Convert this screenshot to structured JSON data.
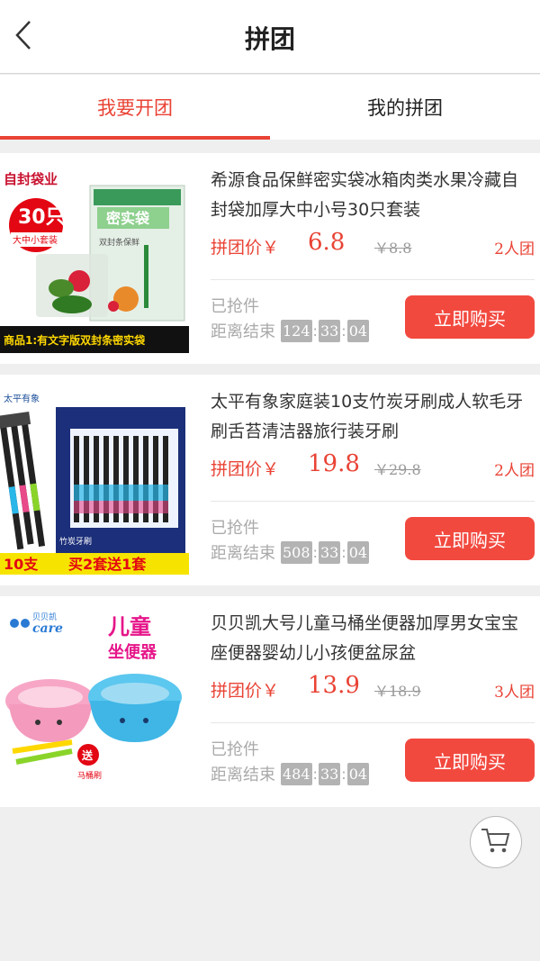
{
  "header": {
    "title": "拼团"
  },
  "tabs": [
    {
      "label": "我要开团",
      "active": true
    },
    {
      "label": "我的拼团",
      "active": false
    }
  ],
  "products": [
    {
      "title": "希源食品保鲜密实袋冰箱肉类水果冷藏自封袋加厚大中小号30只套装",
      "price_label": "拼团价￥",
      "price": "6.8",
      "original_price": "￥8.8",
      "group_size": "2人团",
      "sold_label": "已抢件",
      "countdown_label": "距离结束",
      "countdown": [
        "124",
        "33",
        "04"
      ],
      "buy_label": "立即购买",
      "image_texts": [
        "自封袋业",
        "30只",
        "大中小套装",
        "密实袋",
        "双封条保鲜",
        "商品1:有文字版双封条密实袋"
      ]
    },
    {
      "title": "太平有象家庭装10支竹炭牙刷成人软毛牙刷舌苔清洁器旅行装牙刷",
      "price_label": "拼团价￥",
      "price": "19.8",
      "original_price": "￥29.8",
      "group_size": "2人团",
      "sold_label": "已抢件",
      "countdown_label": "距离结束",
      "countdown": [
        "508",
        "33",
        "04"
      ],
      "buy_label": "立即购买",
      "image_texts": [
        "太平有象",
        "10支",
        "买2套送1套",
        "竹炭牙刷"
      ]
    },
    {
      "title": "贝贝凯大号儿童马桶坐便器加厚男女宝宝座便器婴幼儿小孩便盆尿盆",
      "price_label": "拼团价￥",
      "price": "13.9",
      "original_price": "￥18.9",
      "group_size": "3人团",
      "sold_label": "已抢件",
      "countdown_label": "距离结束",
      "countdown": [
        "484",
        "33",
        "04"
      ],
      "buy_label": "立即购买",
      "image_texts": [
        "贝贝凯",
        "care",
        "儿童",
        "坐便器",
        "送",
        "马桶刷"
      ]
    }
  ],
  "icons": {
    "back": "chevron-left-icon",
    "cart": "shopping-cart-icon"
  },
  "colors": {
    "accent": "#e94335",
    "button": "#f2493f",
    "countdown_bg": "#b3b3b3"
  }
}
